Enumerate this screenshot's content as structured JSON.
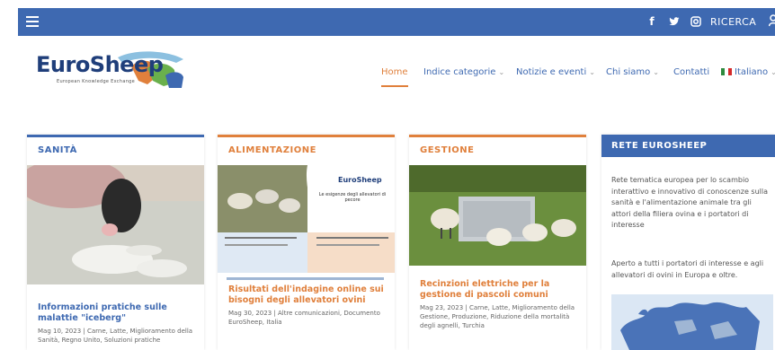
{
  "topbar": {
    "social": [
      {
        "name": "facebook-icon",
        "glyph": "f"
      },
      {
        "name": "twitter-icon",
        "glyph": "t"
      },
      {
        "name": "instagram-icon",
        "glyph": "◘"
      }
    ],
    "search_label": "RICERCA"
  },
  "logo": {
    "title": "EuroSheep",
    "subtitle": "European Knowledge Exchange"
  },
  "nav": {
    "items": [
      {
        "label": "Home",
        "active": true
      },
      {
        "label": "Indice categorie",
        "dropdown": true
      },
      {
        "label": "Notizie e eventi",
        "dropdown": true
      },
      {
        "label": "Chi siamo",
        "dropdown": true
      },
      {
        "label": "Contatti",
        "dropdown": false
      },
      {
        "label": "Italiano",
        "dropdown": true
      }
    ]
  },
  "cards": [
    {
      "category": "SANITÀ",
      "category_color": "#3e69b1",
      "title": "Informazioni pratiche sulle malattie \"iceberg\"",
      "meta": "Mag 10, 2023 | Carne, Latte, Miglioramento della Sanità, Regno Unito, Soluzioni pratiche"
    },
    {
      "category": "ALIMENTAZIONE",
      "category_color": "#e0803c",
      "title": "Risultati dell'indagine online sui bisogni degli allevatori ovini",
      "meta": "Mag 30, 2023 | Altre comunicazioni, Documento EuroSheep, Italia",
      "poster_title": "EuroSheep",
      "poster_text": "Le esigenze degli allevatori di pecore"
    },
    {
      "category": "GESTIONE",
      "category_color": "#e0803c",
      "title": "Recinzioni elettriche per la gestione di pascoli comuni",
      "meta": "Mag 23, 2023 | Carne, Latte, Miglioramento della Gestione, Produzione, Riduzione della mortalità degli agnelli, Turchia"
    }
  ],
  "sidebar": {
    "title": "RETE EUROSHEEP",
    "paragraph1": "Rete tematica europea per lo scambio interattivo e innovativo di conoscenze sulla sanità e l'alimentazione animale tra gli attori della filiera ovina e i portatori di interesse",
    "paragraph2": "Aperto a tutti i portatori di interesse e agli allevatori di ovini in Europa e oltre."
  },
  "colors": {
    "brand_blue": "#3e69b1",
    "accent_orange": "#e0803c"
  }
}
